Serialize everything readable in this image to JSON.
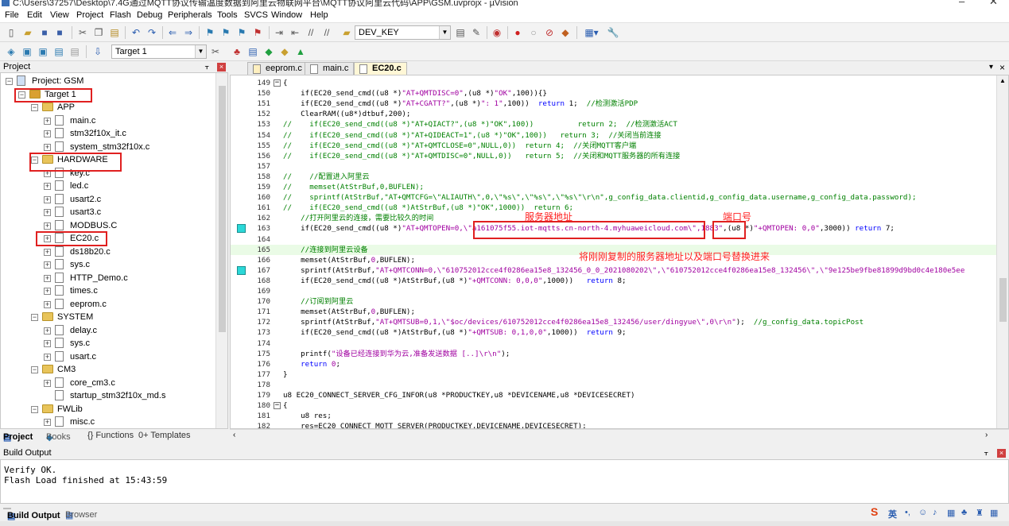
{
  "window": {
    "title": "C:\\Users\\37257\\Desktop\\7.4G通过MQTT协议传输温度数据到阿里云物联网平台\\MQTT协议阿里云代码\\APP\\GSM.uvprojx - µVision",
    "minimize": "–",
    "close": "✕"
  },
  "menu": [
    "File",
    "Edit",
    "View",
    "Project",
    "Flash",
    "Debug",
    "Peripherals",
    "Tools",
    "SVCS",
    "Window",
    "Help"
  ],
  "toolbar": {
    "define_combo": "DEV_KEY",
    "target_combo": "Target 1"
  },
  "project_panel": {
    "title": "Project",
    "tree": [
      {
        "level": 0,
        "label": "Project: GSM",
        "type": "project",
        "exp": "−"
      },
      {
        "level": 1,
        "label": "Target 1",
        "type": "target",
        "exp": "−"
      },
      {
        "level": 2,
        "label": "APP",
        "type": "folder",
        "exp": "−"
      },
      {
        "level": 3,
        "label": "main.c",
        "type": "file",
        "exp": "+"
      },
      {
        "level": 3,
        "label": "stm32f10x_it.c",
        "type": "file",
        "exp": "+"
      },
      {
        "level": 3,
        "label": "system_stm32f10x.c",
        "type": "file",
        "exp": "+"
      },
      {
        "level": 2,
        "label": "HARDWARE",
        "type": "folder",
        "exp": "−"
      },
      {
        "level": 3,
        "label": "key.c",
        "type": "file",
        "exp": "+"
      },
      {
        "level": 3,
        "label": "led.c",
        "type": "file",
        "exp": "+"
      },
      {
        "level": 3,
        "label": "usart2.c",
        "type": "file",
        "exp": "+"
      },
      {
        "level": 3,
        "label": "usart3.c",
        "type": "file",
        "exp": "+"
      },
      {
        "level": 3,
        "label": "MODBUS.C",
        "type": "file",
        "exp": "+"
      },
      {
        "level": 3,
        "label": "EC20.c",
        "type": "file",
        "exp": "+"
      },
      {
        "level": 3,
        "label": "ds18b20.c",
        "type": "file",
        "exp": "+"
      },
      {
        "level": 3,
        "label": "sys.c",
        "type": "file",
        "exp": "+"
      },
      {
        "level": 3,
        "label": "HTTP_Demo.c",
        "type": "file",
        "exp": "+"
      },
      {
        "level": 3,
        "label": "times.c",
        "type": "file",
        "exp": "+"
      },
      {
        "level": 3,
        "label": "eeprom.c",
        "type": "file",
        "exp": "+"
      },
      {
        "level": 2,
        "label": "SYSTEM",
        "type": "folder",
        "exp": "−"
      },
      {
        "level": 3,
        "label": "delay.c",
        "type": "file",
        "exp": "+"
      },
      {
        "level": 3,
        "label": "sys.c",
        "type": "file",
        "exp": "+"
      },
      {
        "level": 3,
        "label": "usart.c",
        "type": "file",
        "exp": "+"
      },
      {
        "level": 2,
        "label": "CM3",
        "type": "folder",
        "exp": "−"
      },
      {
        "level": 3,
        "label": "core_cm3.c",
        "type": "file",
        "exp": "+"
      },
      {
        "level": 3,
        "label": "startup_stm32f10x_md.s",
        "type": "file",
        "exp": ""
      },
      {
        "level": 2,
        "label": "FWLib",
        "type": "folder",
        "exp": "−"
      },
      {
        "level": 3,
        "label": "misc.c",
        "type": "file",
        "exp": "+"
      }
    ],
    "tabs": [
      "Project",
      "Books",
      "{} Functions",
      "0+ Templates"
    ]
  },
  "editor": {
    "tabs": [
      "eeprom.c",
      "main.c",
      "EC20.c"
    ],
    "active_tab": "EC20.c",
    "lines": [
      {
        "n": "149",
        "segs": [
          [
            "p",
            "{"
          ]
        ]
      },
      {
        "n": "150",
        "segs": [
          [
            "p",
            "    if(EC20_send_cmd((u8 *)"
          ],
          [
            "s",
            "\"AT+QMTDISC=0\""
          ],
          [
            "p",
            ",(u8 *)"
          ],
          [
            "s",
            "\"OK\""
          ],
          [
            "p",
            ",100)){}"
          ]
        ]
      },
      {
        "n": "151",
        "segs": [
          [
            "p",
            "    if(EC20_send_cmd((u8 *)"
          ],
          [
            "s",
            "\"AT+CGATT?\""
          ],
          [
            "p",
            ",(u8 *)"
          ],
          [
            "s",
            "\": 1\""
          ],
          [
            "p",
            ",100))  "
          ],
          [
            "k",
            "return"
          ],
          [
            "p",
            " 1;  "
          ],
          [
            "c",
            "//检测激活PDP"
          ]
        ]
      },
      {
        "n": "152",
        "segs": [
          [
            "p",
            "    ClearRAM((u8*)dtbuf,200);"
          ]
        ]
      },
      {
        "n": "153",
        "segs": [
          [
            "c",
            "//    if(EC20_send_cmd((u8 *)\"AT+QIACT?\",(u8 *)\"OK\",100))          return 2;  //检测激活ACT"
          ]
        ]
      },
      {
        "n": "154",
        "segs": [
          [
            "c",
            "//    if(EC20_send_cmd((u8 *)\"AT+QIDEACT=1\",(u8 *)\"OK\",100))   return 3;  //关闭当前连接"
          ]
        ]
      },
      {
        "n": "155",
        "segs": [
          [
            "c",
            "//    if(EC20_send_cmd((u8 *)\"AT+QMTCLOSE=0\",NULL,0))  return 4;  //关闭MQTT客户端"
          ]
        ]
      },
      {
        "n": "156",
        "segs": [
          [
            "c",
            "//    if(EC20_send_cmd((u8 *)\"AT+QMTDISC=0\",NULL,0))   return 5;  //关闭和MQTT服务器的所有连接"
          ]
        ]
      },
      {
        "n": "157",
        "segs": [
          [
            "p",
            ""
          ]
        ]
      },
      {
        "n": "158",
        "segs": [
          [
            "c",
            "//    //配置进入阿里云"
          ]
        ]
      },
      {
        "n": "159",
        "segs": [
          [
            "c",
            "//    memset(AtStrBuf,0,BUFLEN);"
          ]
        ]
      },
      {
        "n": "160",
        "segs": [
          [
            "c",
            "//    sprintf(AtStrBuf,\"AT+QMTCFG=\\\"ALIAUTH\\\",0,\\\"%s\\\",\\\"%s\\\",\\\"%s\\\"\\r\\n\",g_config_data.clientid,g_config_data.username,g_config_data.password);"
          ]
        ]
      },
      {
        "n": "161",
        "segs": [
          [
            "c",
            "//    if(EC20_send_cmd((u8 *)AtStrBuf,(u8 *)\"OK\",1000))  return 6;"
          ]
        ]
      },
      {
        "n": "162",
        "segs": [
          [
            "c",
            "    //打开阿里云的连接，需要比较久的时间"
          ]
        ]
      },
      {
        "n": "163",
        "segs": [
          [
            "p",
            "    if(EC20_send_cmd((u8 *)"
          ],
          [
            "s",
            "\"AT+QMTOPEN=0,\\\"a161075f55.iot-mqtts.cn-north-4.myhuaweicloud.com\\\",1883\""
          ],
          [
            "p",
            ",(u8 *)"
          ],
          [
            "s",
            "\"+QMTOPEN: 0,0\""
          ],
          [
            "p",
            ",3000)) "
          ],
          [
            "k",
            "return"
          ],
          [
            "p",
            " 7;"
          ]
        ]
      },
      {
        "n": "164",
        "segs": [
          [
            "p",
            ""
          ]
        ]
      },
      {
        "n": "165",
        "segs": [
          [
            "c",
            "    //连接到阿里云设备"
          ]
        ]
      },
      {
        "n": "166",
        "segs": [
          [
            "p",
            "    memset(AtStrBuf,"
          ],
          [
            "m",
            "0"
          ],
          [
            "p",
            ",BUFLEN);"
          ]
        ]
      },
      {
        "n": "167",
        "segs": [
          [
            "p",
            "    sprintf(AtStrBuf,"
          ],
          [
            "s",
            "\"AT+QMTCONN=0,\\\"610752012cce4f0286ea15e8_132456_0_0_2021080202\\\",\\\"610752012cce4f0286ea15e8_132456\\\",\\\"9e125be9fbe81899d9bd0c4e180e5ee"
          ]
        ]
      },
      {
        "n": "168",
        "segs": [
          [
            "p",
            "    if(EC20_send_cmd((u8 *)AtStrBuf,(u8 *)"
          ],
          [
            "s",
            "\"+QMTCONN: 0,0,0\""
          ],
          [
            "p",
            ",1000))   "
          ],
          [
            "k",
            "return"
          ],
          [
            "p",
            " 8;"
          ]
        ]
      },
      {
        "n": "169",
        "segs": [
          [
            "p",
            ""
          ]
        ]
      },
      {
        "n": "170",
        "segs": [
          [
            "c",
            "    //订阅到阿里云"
          ]
        ]
      },
      {
        "n": "171",
        "segs": [
          [
            "p",
            "    memset(AtStrBuf,"
          ],
          [
            "m",
            "0"
          ],
          [
            "p",
            ",BUFLEN);"
          ]
        ]
      },
      {
        "n": "172",
        "segs": [
          [
            "p",
            "    sprintf(AtStrBuf,"
          ],
          [
            "s",
            "\"AT+QMTSUB=0,1,\\\"$oc/devices/610752012cce4f0286ea15e8_132456/user/dingyue\\\",0\\r\\n\""
          ],
          [
            "p",
            ");  "
          ],
          [
            "c",
            "//g_config_data.topicPost"
          ]
        ]
      },
      {
        "n": "173",
        "segs": [
          [
            "p",
            "    if(EC20_send_cmd((u8 *)AtStrBuf,(u8 *)"
          ],
          [
            "s",
            "\"+QMTSUB: 0,1,0,0\""
          ],
          [
            "p",
            ",1000))  "
          ],
          [
            "k",
            "return"
          ],
          [
            "p",
            " 9;"
          ]
        ]
      },
      {
        "n": "174",
        "segs": [
          [
            "p",
            ""
          ]
        ]
      },
      {
        "n": "175",
        "segs": [
          [
            "p",
            "    printf("
          ],
          [
            "s",
            "\"设备已经连接到华为云,准备发送数据 [..]\\r\\n\""
          ],
          [
            "p",
            ");"
          ]
        ]
      },
      {
        "n": "176",
        "segs": [
          [
            "p",
            "    "
          ],
          [
            "k",
            "return"
          ],
          [
            "p",
            " "
          ],
          [
            "m",
            "0"
          ],
          [
            "p",
            ";"
          ]
        ]
      },
      {
        "n": "177",
        "segs": [
          [
            "p",
            "}"
          ]
        ]
      },
      {
        "n": "178",
        "segs": [
          [
            "p",
            ""
          ]
        ]
      },
      {
        "n": "179",
        "segs": [
          [
            "p",
            "u8 EC20_CONNECT_SERVER_CFG_INFOR(u8 *PRODUCTKEY,u8 *DEVICENAME,u8 *DEVICESECRET)"
          ]
        ]
      },
      {
        "n": "180",
        "segs": [
          [
            "p",
            "{"
          ]
        ]
      },
      {
        "n": "181",
        "segs": [
          [
            "p",
            "    u8 res;"
          ]
        ]
      },
      {
        "n": "182",
        "segs": [
          [
            "p",
            "    res=EC20_CONNECT_MQTT_SERVER(PRODUCTKEY,DEVICENAME,DEVICESECRET);"
          ]
        ]
      }
    ],
    "annotations": {
      "server_addr": "服务器地址",
      "port": "端口号",
      "replace_hint": "将刚刚复制的服务器地址以及端口号替换进来"
    }
  },
  "build_output": {
    "title": "Build Output",
    "lines": [
      "Verify OK.",
      "Flash Load finished at 15:43:59"
    ],
    "tabs": [
      "Build Output",
      "Browser"
    ]
  },
  "ime": {
    "lang": "英"
  }
}
